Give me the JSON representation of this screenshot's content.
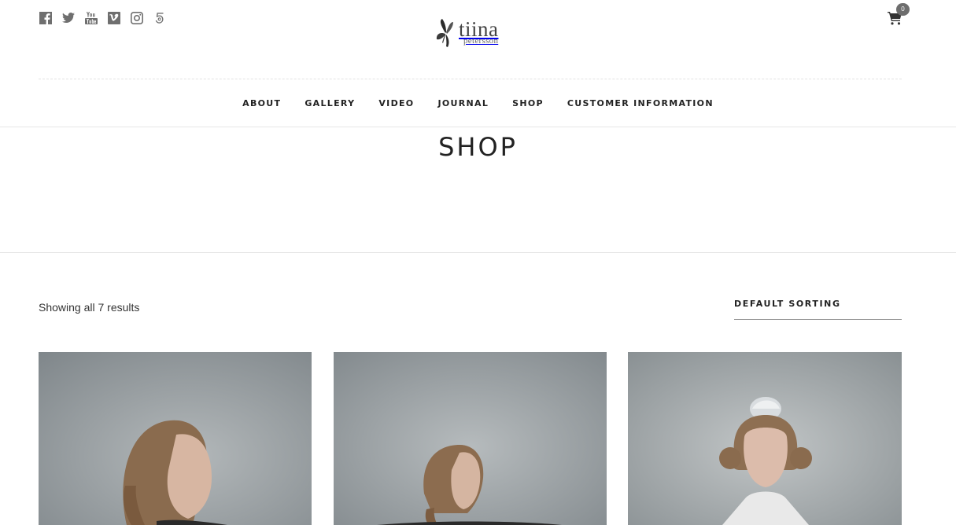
{
  "header": {
    "social_icons": [
      "facebook-icon",
      "twitter-icon",
      "youtube-icon",
      "vimeo-icon",
      "instagram-icon",
      "500px-icon"
    ],
    "logo": {
      "name": "tiina",
      "sub": "petersson"
    },
    "cart": {
      "count": "0",
      "icon": "cart-icon"
    }
  },
  "nav": {
    "items": [
      {
        "label": "ABOUT"
      },
      {
        "label": "GALLERY"
      },
      {
        "label": "VIDEO"
      },
      {
        "label": "JOURNAL"
      },
      {
        "label": "SHOP"
      },
      {
        "label": "CUSTOMER INFORMATION"
      }
    ]
  },
  "page": {
    "title": "SHOP",
    "results": "Showing all 7 results",
    "sorting": "DEFAULT SORTING"
  },
  "colors": {
    "icon_gray": "#6f6f6f",
    "text_dark": "#222222",
    "photo_backdrop": "#9da3a6"
  }
}
